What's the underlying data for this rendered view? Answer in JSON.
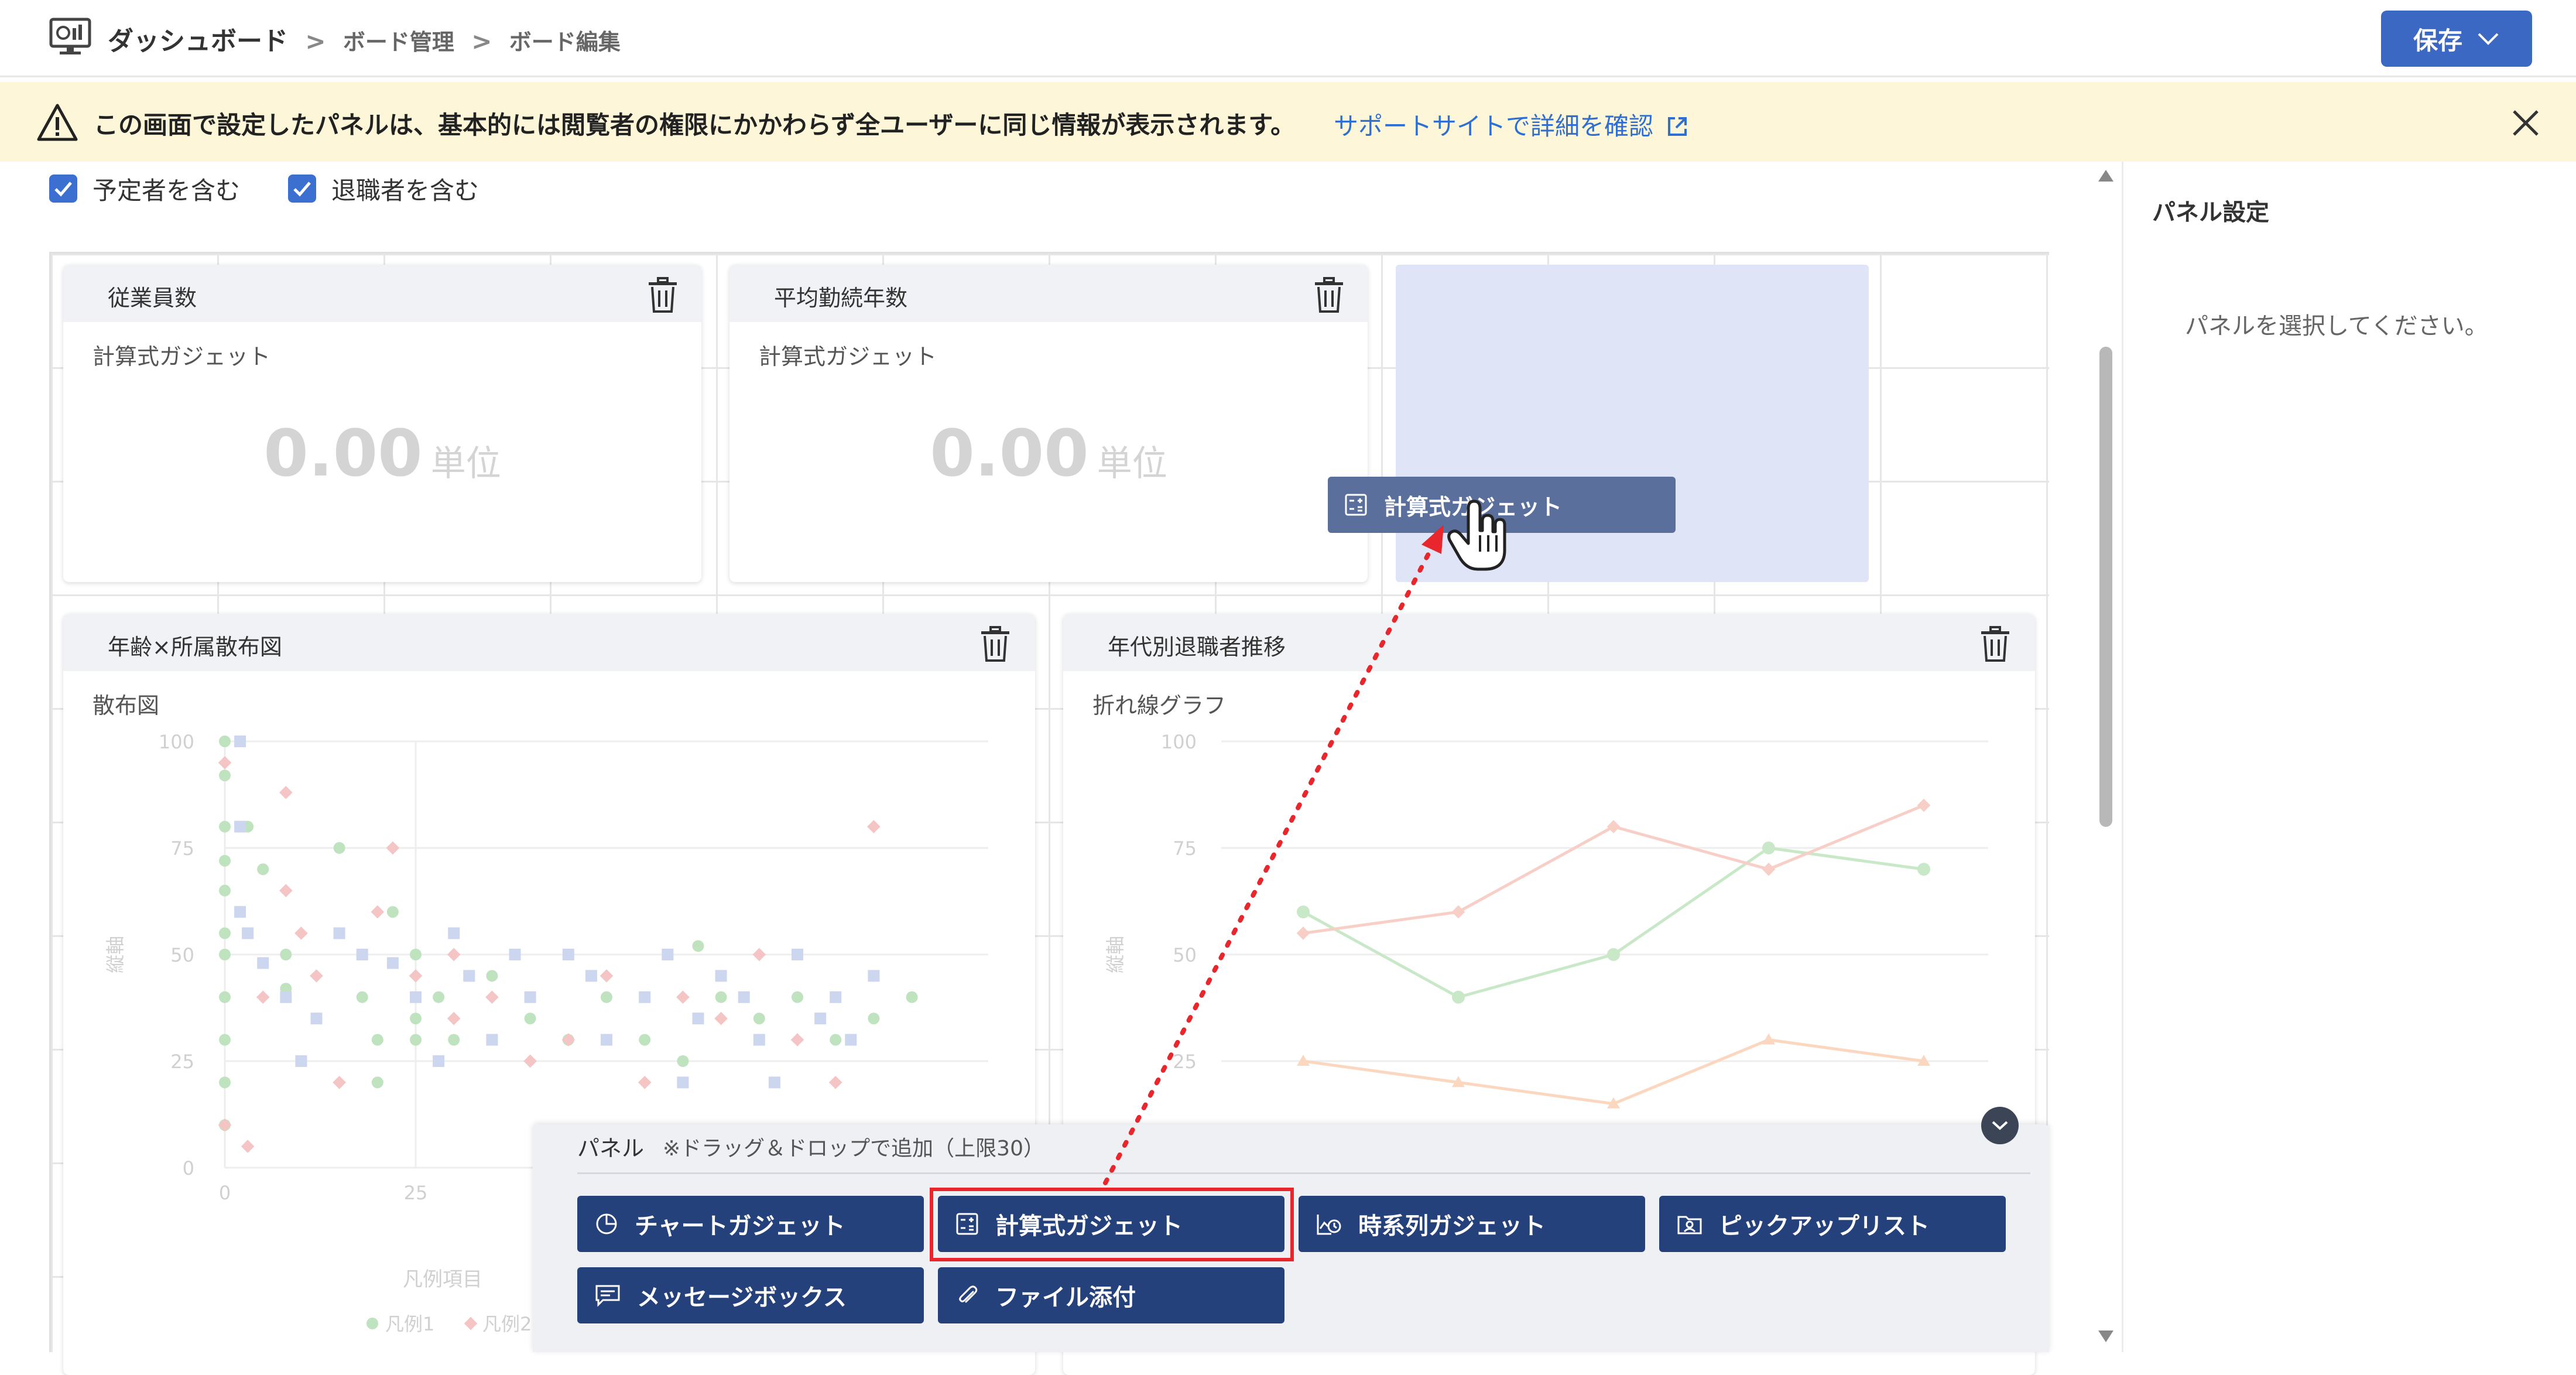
{
  "header": {
    "title": "ダッシュボード",
    "breadcrumb": [
      "ボード管理",
      "ボード編集"
    ],
    "separator": ">",
    "save_label": "保存"
  },
  "banner": {
    "message": "この画面で設定したパネルは、基本的には閲覧者の権限にかかわらず全ユーザーに同じ情報が表示されます。",
    "link": "サポートサイトで詳細を確認"
  },
  "filters": {
    "include_planned": {
      "label": "予定者を含む",
      "checked": true
    },
    "include_retired": {
      "label": "退職者を含む",
      "checked": true
    }
  },
  "panels": {
    "employees": {
      "title": "従業員数",
      "type": "計算式ガジェット",
      "value": "0.00",
      "unit": "単位"
    },
    "tenure": {
      "title": "平均勤続年数",
      "type": "計算式ガジェット",
      "value": "0.00",
      "unit": "単位"
    },
    "scatter": {
      "title": "年齢×所属散布図",
      "type": "散布図"
    },
    "line": {
      "title": "年代別退職者推移",
      "type": "折れ線グラフ"
    }
  },
  "drag_chip": {
    "label": "計算式ガジェット"
  },
  "chart_data": [
    {
      "type": "scatter",
      "title": "",
      "ylabel": "縦軸",
      "ylim": [
        0,
        100
      ],
      "y_ticks": [
        0,
        25,
        50,
        75,
        100
      ],
      "x_ticks": [
        0,
        25
      ],
      "legend_title": "凡例項目",
      "legend": [
        "凡例1",
        "凡例2"
      ],
      "series": [
        {
          "name": "凡例1",
          "color": "#bfe3bf",
          "points": [
            [
              0,
              100
            ],
            [
              0,
              92
            ],
            [
              0,
              80
            ],
            [
              0,
              72
            ],
            [
              0,
              65
            ],
            [
              0,
              55
            ],
            [
              0,
              50
            ],
            [
              0,
              40
            ],
            [
              0,
              30
            ],
            [
              0,
              20
            ],
            [
              0,
              10
            ],
            [
              3,
              80
            ],
            [
              5,
              70
            ],
            [
              8,
              50
            ],
            [
              8,
              42
            ],
            [
              15,
              75
            ],
            [
              18,
              40
            ],
            [
              20,
              30
            ],
            [
              20,
              20
            ],
            [
              22,
              60
            ],
            [
              25,
              50
            ],
            [
              25,
              35
            ],
            [
              25,
              30
            ],
            [
              28,
              40
            ],
            [
              30,
              30
            ],
            [
              35,
              45
            ],
            [
              40,
              35
            ],
            [
              45,
              30
            ],
            [
              50,
              40
            ],
            [
              55,
              30
            ],
            [
              60,
              25
            ],
            [
              62,
              52
            ],
            [
              65,
              40
            ],
            [
              70,
              35
            ],
            [
              75,
              40
            ],
            [
              80,
              30
            ],
            [
              85,
              35
            ],
            [
              90,
              40
            ]
          ]
        },
        {
          "name": "凡例2",
          "color": "#f5c5c5",
          "points": [
            [
              0,
              95
            ],
            [
              0,
              10
            ],
            [
              3,
              5
            ],
            [
              5,
              40
            ],
            [
              8,
              65
            ],
            [
              8,
              88
            ],
            [
              10,
              55
            ],
            [
              12,
              45
            ],
            [
              15,
              20
            ],
            [
              20,
              60
            ],
            [
              22,
              75
            ],
            [
              25,
              45
            ],
            [
              30,
              50
            ],
            [
              30,
              35
            ],
            [
              35,
              40
            ],
            [
              40,
              25
            ],
            [
              45,
              30
            ],
            [
              50,
              45
            ],
            [
              55,
              20
            ],
            [
              60,
              40
            ],
            [
              65,
              35
            ],
            [
              70,
              50
            ],
            [
              75,
              30
            ],
            [
              80,
              20
            ],
            [
              85,
              80
            ]
          ]
        },
        {
          "name": "",
          "color": "#ccd6ee",
          "points": [
            [
              2,
              100
            ],
            [
              2,
              80
            ],
            [
              2,
              60
            ],
            [
              3,
              55
            ],
            [
              5,
              48
            ],
            [
              8,
              40
            ],
            [
              10,
              25
            ],
            [
              12,
              35
            ],
            [
              15,
              55
            ],
            [
              18,
              50
            ],
            [
              22,
              48
            ],
            [
              25,
              40
            ],
            [
              28,
              25
            ],
            [
              30,
              55
            ],
            [
              32,
              45
            ],
            [
              35,
              30
            ],
            [
              38,
              50
            ],
            [
              40,
              40
            ],
            [
              45,
              50
            ],
            [
              48,
              45
            ],
            [
              50,
              30
            ],
            [
              55,
              40
            ],
            [
              58,
              50
            ],
            [
              60,
              20
            ],
            [
              62,
              35
            ],
            [
              65,
              45
            ],
            [
              68,
              40
            ],
            [
              70,
              30
            ],
            [
              72,
              20
            ],
            [
              75,
              50
            ],
            [
              78,
              35
            ],
            [
              80,
              40
            ],
            [
              82,
              30
            ],
            [
              85,
              45
            ]
          ]
        }
      ]
    },
    {
      "type": "line",
      "title": "",
      "ylabel": "縦軸",
      "ylim": [
        0,
        100
      ],
      "y_ticks": [
        25,
        50,
        75,
        100
      ],
      "series": [
        {
          "name": "",
          "color": "#c8e8c8",
          "values": [
            60,
            40,
            50,
            75,
            70
          ]
        },
        {
          "name": "",
          "color": "#f8cfc7",
          "values": [
            55,
            60,
            80,
            70,
            85
          ]
        },
        {
          "name": "",
          "color": "#fbd7c0",
          "values": [
            25,
            20,
            15,
            30,
            25
          ]
        }
      ]
    }
  ],
  "palette": {
    "title": "パネル",
    "note": "※ドラッグ＆ドロップで追加（上限30）",
    "items": [
      {
        "label": "チャートガジェット",
        "icon": "pie-chart-icon"
      },
      {
        "label": "計算式ガジェット",
        "icon": "calculator-icon",
        "highlighted": true
      },
      {
        "label": "時系列ガジェット",
        "icon": "time-series-icon"
      },
      {
        "label": "ピックアップリスト",
        "icon": "pickup-list-icon"
      },
      {
        "label": "メッセージボックス",
        "icon": "message-icon"
      },
      {
        "label": "ファイル添付",
        "icon": "paperclip-icon"
      }
    ]
  },
  "settings_panel": {
    "title": "パネル設定",
    "empty_message": "パネルを選択してください。"
  },
  "colors": {
    "primary": "#24417c",
    "accent": "#3b68c2",
    "banner_bg": "#fdf6d8",
    "highlight": "#e8262b"
  }
}
